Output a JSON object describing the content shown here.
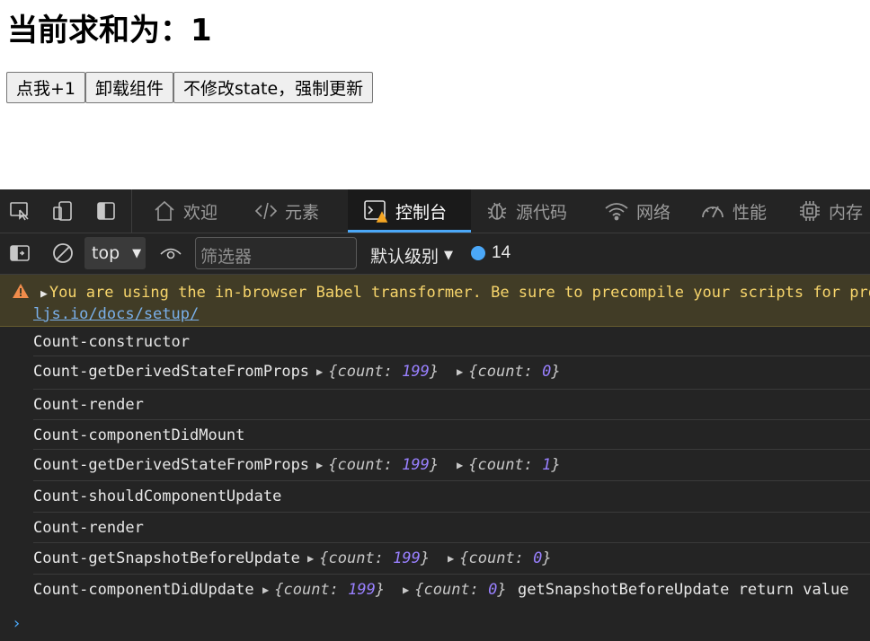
{
  "page": {
    "heading": "当前求和为：1",
    "buttons": [
      "点我+1",
      "卸载组件",
      "不修改state，强制更新"
    ]
  },
  "devtools": {
    "tabs": [
      {
        "label": "欢迎",
        "icon": "home-icon"
      },
      {
        "label": "元素",
        "icon": "code-icon"
      },
      {
        "label": "控制台",
        "icon": "console-icon",
        "active": true
      },
      {
        "label": "源代码",
        "icon": "bug-icon"
      },
      {
        "label": "网络",
        "icon": "wifi-icon"
      },
      {
        "label": "性能",
        "icon": "gauge-icon"
      },
      {
        "label": "内存",
        "icon": "chip-icon"
      }
    ],
    "toolbar": {
      "context": "top",
      "filter_placeholder": "筛选器",
      "level": "默认级别",
      "message_count": "14"
    },
    "console": {
      "warning": {
        "text": "You are using the in-browser Babel transformer. Be sure to precompile your scripts for produ",
        "link": "ljs.io/docs/setup/"
      },
      "rows": [
        {
          "text": "Count-constructor"
        },
        {
          "text": "Count-getDerivedStateFromProps",
          "objs": [
            {
              "key": "count",
              "value": "199"
            },
            {
              "key": "count",
              "value": "0"
            }
          ]
        },
        {
          "text": "Count-render"
        },
        {
          "text": "Count-componentDidMount"
        },
        {
          "text": "Count-getDerivedStateFromProps",
          "objs": [
            {
              "key": "count",
              "value": "199"
            },
            {
              "key": "count",
              "value": "1"
            }
          ]
        },
        {
          "text": "Count-shouldComponentUpdate"
        },
        {
          "text": "Count-render"
        },
        {
          "text": "Count-getSnapshotBeforeUpdate",
          "objs": [
            {
              "key": "count",
              "value": "199"
            },
            {
              "key": "count",
              "value": "0"
            }
          ]
        },
        {
          "text": "Count-componentDidUpdate",
          "objs": [
            {
              "key": "count",
              "value": "199"
            },
            {
              "key": "count",
              "value": "0"
            }
          ],
          "extra": "getSnapshotBeforeUpdate return value"
        }
      ],
      "prompt": "›"
    },
    "colors": {
      "accent": "#4ba8f8",
      "warning_bg": "#413c26",
      "warning_text": "#f7d56b",
      "number": "#9980ff"
    }
  }
}
